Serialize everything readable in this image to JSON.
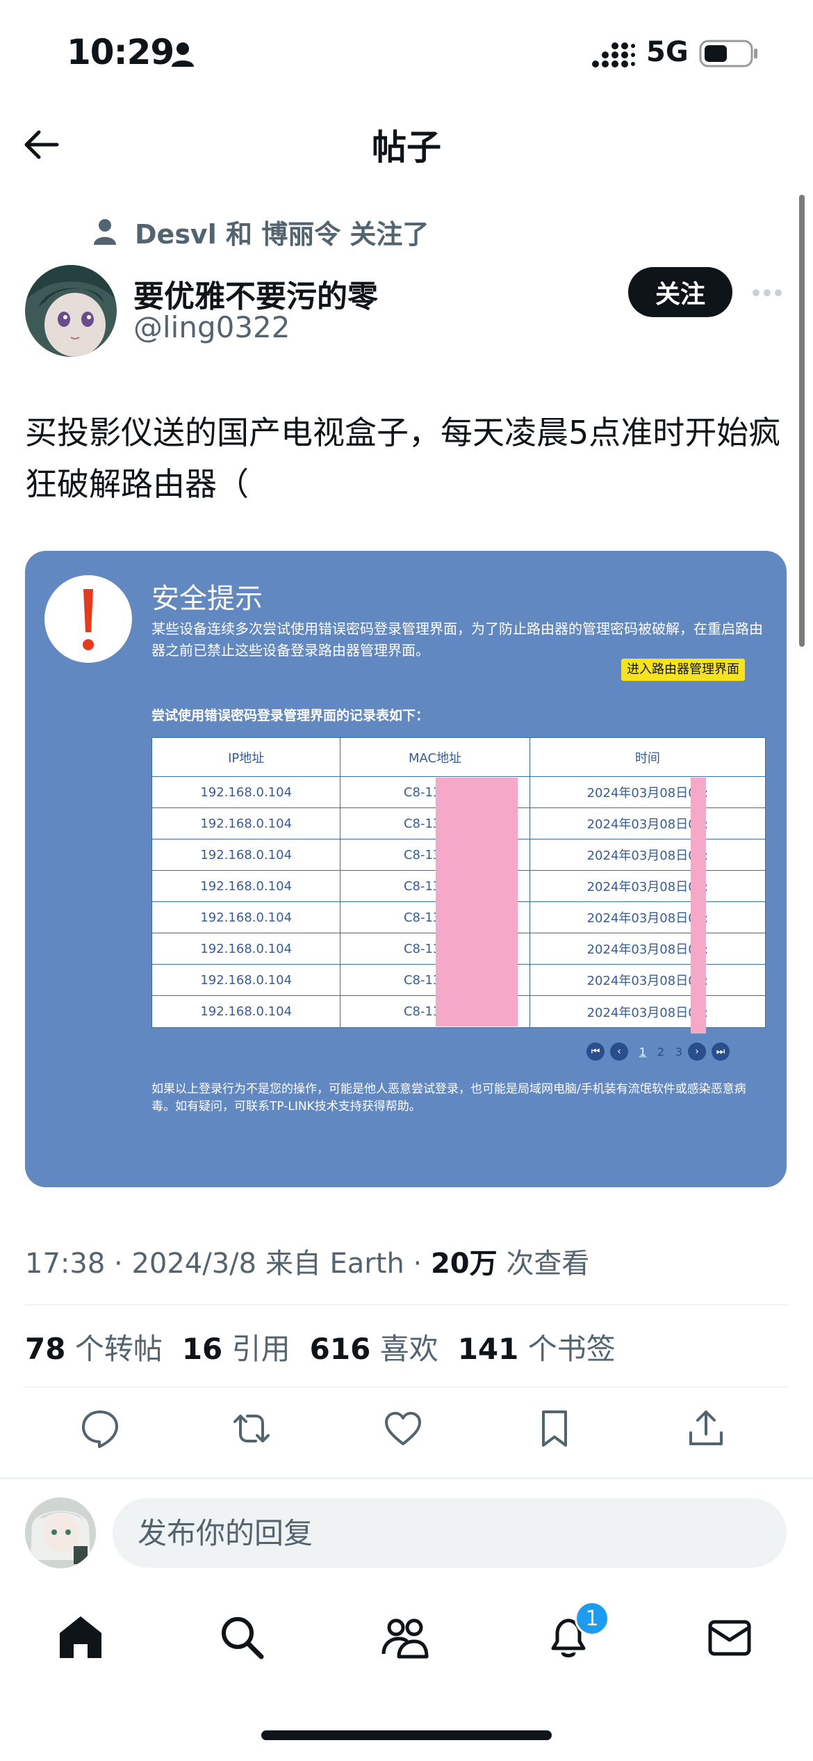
{
  "status_bar": {
    "time": "10:29",
    "network": "5G"
  },
  "header": {
    "title": "帖子"
  },
  "post": {
    "social_context": "Desvl 和 博丽令 关注了",
    "display_name": "要优雅不要污的零",
    "handle": "@ling0322",
    "follow_label": "关注",
    "text": "买投影仪送的国产电视盒子，每天凌晨5点准时开始疯狂破解路由器（",
    "media": {
      "title": "安全提示",
      "description": "某些设备连续多次尝试使用错误密码登录管理界面，为了防止路由器的管理密码被破解，在重启路由器之前已禁止这些设备登录路由器管理界面。",
      "button_label": "进入路由器管理界面",
      "table_caption": "尝试使用错误密码登录管理界面的记录表如下：",
      "columns": [
        "IP地址",
        "MAC地址",
        "时间"
      ],
      "rows": [
        [
          "192.168.0.104",
          "C8-13-8B-",
          "2024年03月08日05:"
        ],
        [
          "192.168.0.104",
          "C8-13-8B-",
          "2024年03月08日05:"
        ],
        [
          "192.168.0.104",
          "C8-13-8B-",
          "2024年03月08日05:"
        ],
        [
          "192.168.0.104",
          "C8-13-8B-",
          "2024年03月08日05:"
        ],
        [
          "192.168.0.104",
          "C8-13-8B-",
          "2024年03月08日05:"
        ],
        [
          "192.168.0.104",
          "C8-13-8B-",
          "2024年03月08日05:"
        ],
        [
          "192.168.0.104",
          "C8-13-8B-",
          "2024年03月08日05:"
        ],
        [
          "192.168.0.104",
          "C8-13-8B-",
          "2024年03月08日05:"
        ]
      ],
      "pagination": {
        "pages": [
          "1",
          "2",
          "3"
        ],
        "current": "1"
      },
      "footer": "如果以上登录行为不是您的操作，可能是他人恶意尝试登录，也可能是局域网电脑/手机装有流氓软件或感染恶意病毒。如有疑问，可联系TP-LINK技术支持获得帮助。",
      "colors": {
        "background": "#6288c2",
        "alert": "#e8391d",
        "button": "#f7e21f",
        "redaction": "#f6a8c8"
      }
    },
    "meta": {
      "time": "17:38",
      "date": "2024/3/8",
      "source": "来自 Earth",
      "views": "20万",
      "views_label": "次查看"
    },
    "stats": {
      "reposts": "78",
      "reposts_label": "个转帖",
      "quotes": "16",
      "quotes_label": "引用",
      "likes": "616",
      "likes_label": "喜欢",
      "bookmarks": "141",
      "bookmarks_label": "个书签"
    }
  },
  "reply": {
    "placeholder": "发布你的回复"
  },
  "tab_bar": {
    "icons": [
      "home-icon",
      "search-icon",
      "communities-icon",
      "notifications-icon",
      "messages-icon"
    ],
    "notification_count": "1"
  }
}
